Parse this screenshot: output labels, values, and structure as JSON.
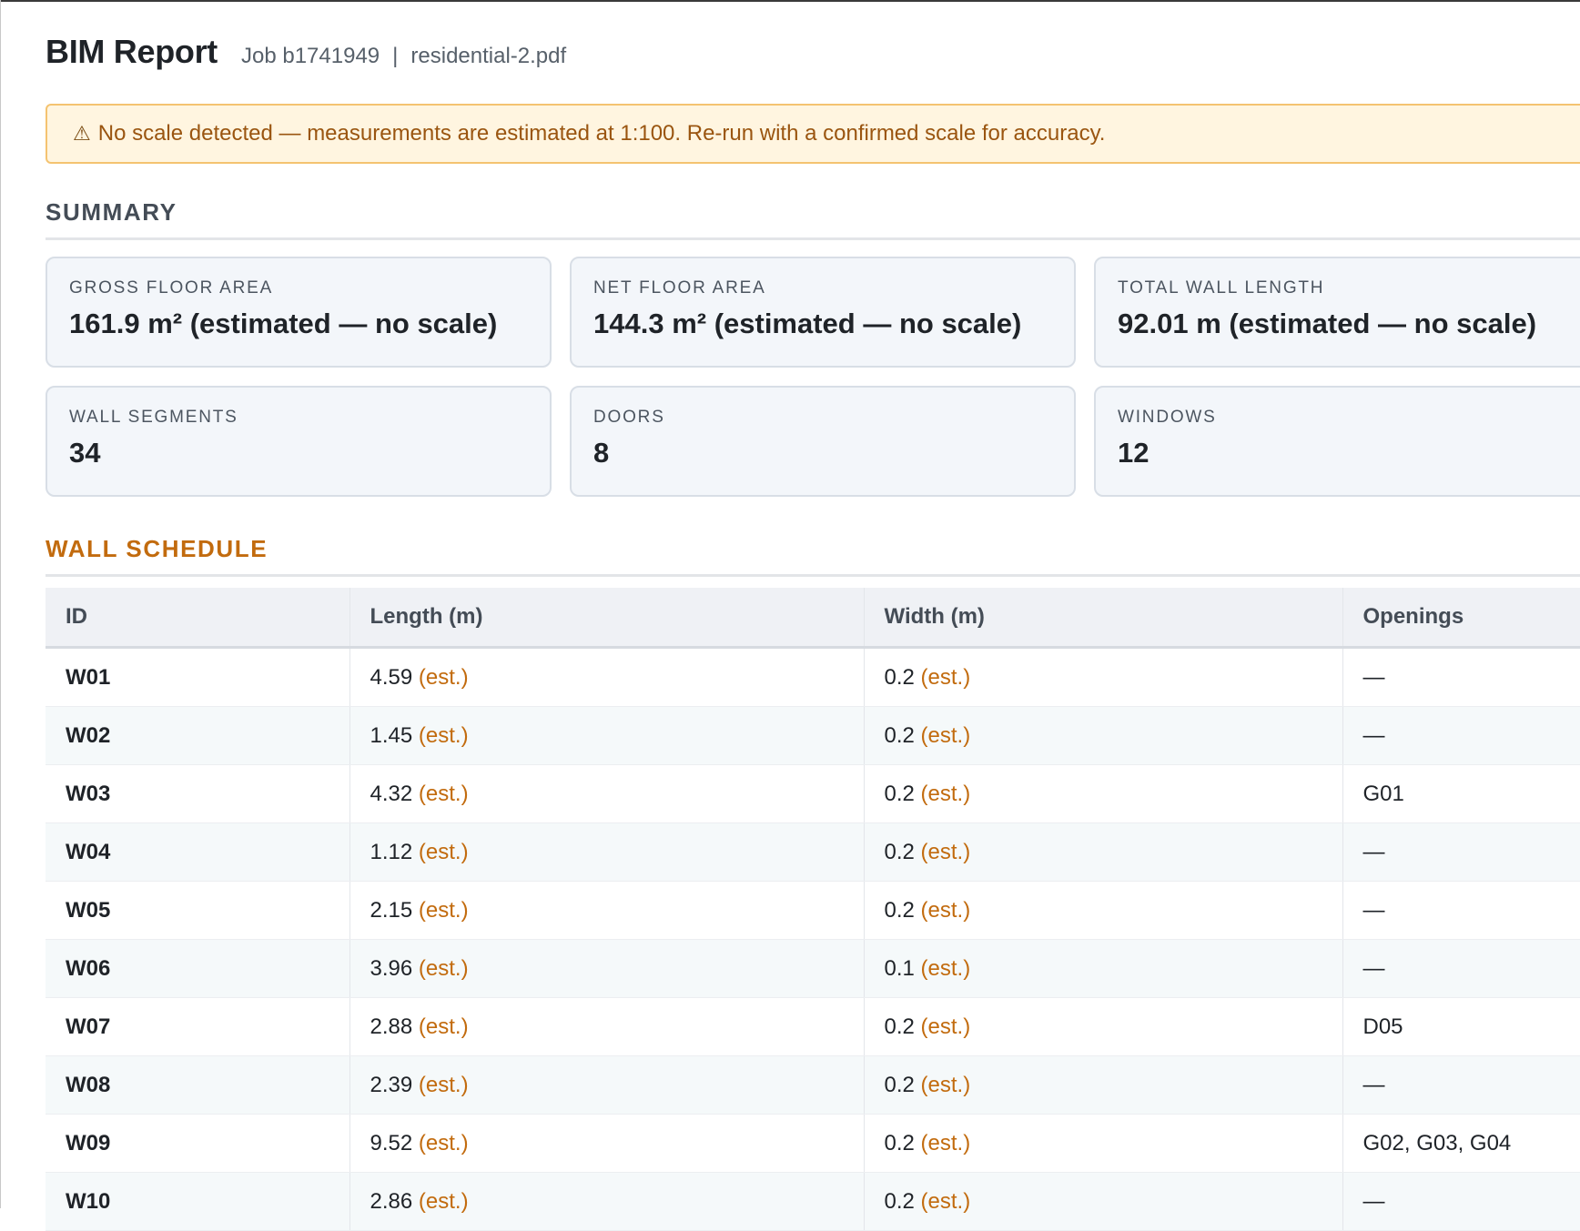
{
  "header": {
    "title": "BIM Report",
    "job": "Job b1741949",
    "separator": "|",
    "file": "residential-2.pdf"
  },
  "banner": {
    "icon": "⚠",
    "text": "No scale detected — measurements are estimated at 1:100. Re-run with a confirmed scale for accuracy."
  },
  "summary": {
    "heading": "SUMMARY",
    "cards": [
      {
        "label": "GROSS FLOOR AREA",
        "value": "161.9 m² (estimated — no scale)"
      },
      {
        "label": "NET FLOOR AREA",
        "value": "144.3 m² (estimated — no scale)"
      },
      {
        "label": "TOTAL WALL LENGTH",
        "value": "92.01 m (estimated — no scale)"
      },
      {
        "label": "WALL SEGMENTS",
        "value": "34"
      },
      {
        "label": "DOORS",
        "value": "8"
      },
      {
        "label": "WINDOWS",
        "value": "12"
      }
    ]
  },
  "wall_schedule": {
    "heading": "WALL SCHEDULE",
    "est_marker": "(est.)",
    "columns": [
      "ID",
      "Length (m)",
      "Width (m)",
      "Openings"
    ],
    "rows": [
      {
        "id": "W01",
        "length": "4.59",
        "width": "0.2",
        "openings": "—"
      },
      {
        "id": "W02",
        "length": "1.45",
        "width": "0.2",
        "openings": "—"
      },
      {
        "id": "W03",
        "length": "4.32",
        "width": "0.2",
        "openings": "G01"
      },
      {
        "id": "W04",
        "length": "1.12",
        "width": "0.2",
        "openings": "—"
      },
      {
        "id": "W05",
        "length": "2.15",
        "width": "0.2",
        "openings": "—"
      },
      {
        "id": "W06",
        "length": "3.96",
        "width": "0.1",
        "openings": "—"
      },
      {
        "id": "W07",
        "length": "2.88",
        "width": "0.2",
        "openings": "D05"
      },
      {
        "id": "W08",
        "length": "2.39",
        "width": "0.2",
        "openings": "—"
      },
      {
        "id": "W09",
        "length": "9.52",
        "width": "0.2",
        "openings": "G02, G03, G04"
      },
      {
        "id": "W10",
        "length": "2.86",
        "width": "0.2",
        "openings": "—"
      }
    ]
  },
  "colors": {
    "accent": "#c26b0e",
    "banner_bg": "#fff5e0",
    "banner_border": "#f4c370",
    "card_bg": "#f3f6fa"
  }
}
